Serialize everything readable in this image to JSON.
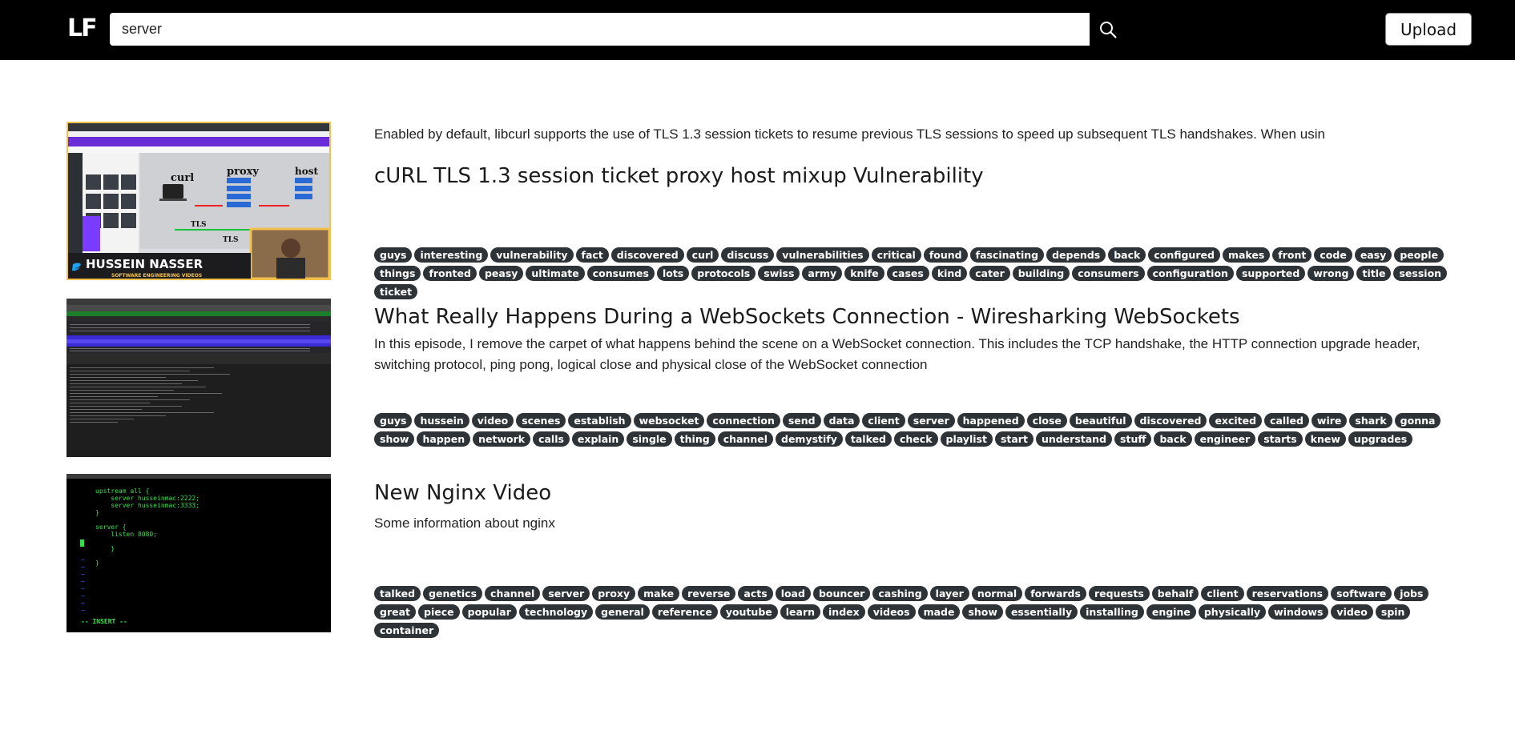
{
  "header": {
    "logo": "LF",
    "search_value": "server",
    "upload_label": "Upload"
  },
  "results": [
    {
      "snippet": "Enabled by default, libcurl supports the use of TLS 1.3 session tickets to resume previous TLS sessions to speed up subsequent TLS handshakes. When usin",
      "title": "cURL TLS 1.3 session ticket proxy host mixup Vulnerability",
      "thumbnail": {
        "labels": [
          "curl",
          "proxy",
          "host",
          "TLS",
          "TLS",
          "HUSSEIN NASSER",
          "SOFTWARE ENGINEERING VIDEOS"
        ]
      },
      "tags": [
        "guys",
        "interesting",
        "vulnerability",
        "fact",
        "discovered",
        "curl",
        "discuss",
        "vulnerabilities",
        "critical",
        "found",
        "fascinating",
        "depends",
        "back",
        "configured",
        "makes",
        "front",
        "code",
        "easy",
        "people",
        "things",
        "fronted",
        "peasy",
        "ultimate",
        "consumes",
        "lots",
        "protocols",
        "swiss",
        "army",
        "knife",
        "cases",
        "kind",
        "cater",
        "building",
        "consumers",
        "configuration",
        "supported",
        "wrong",
        "title",
        "session",
        "ticket"
      ]
    },
    {
      "title": "What Really Happens During a WebSockets Connection - Wiresharking WebSockets",
      "description": "In this episode, I remove the carpet of what happens behind the scene on a WebSocket connection. This includes the TCP handshake, the HTTP connection upgrade header, switching protocol, ping pong, logical close and physical close of the WebSocket connection",
      "tags": [
        "guys",
        "hussein",
        "video",
        "scenes",
        "establish",
        "websocket",
        "connection",
        "send",
        "data",
        "client",
        "server",
        "happened",
        "close",
        "beautiful",
        "discovered",
        "excited",
        "called",
        "wire",
        "shark",
        "gonna",
        "show",
        "happen",
        "network",
        "calls",
        "explain",
        "single",
        "thing",
        "channel",
        "demystify",
        "talked",
        "check",
        "playlist",
        "start",
        "understand",
        "stuff",
        "back",
        "engineer",
        "starts",
        "knew",
        "upgrades"
      ]
    },
    {
      "title": "New Nginx Video",
      "description": "Some information about nginx",
      "thumbnail": {
        "code_lines": [
          "upstream all {",
          "    server husseinmac:2222;",
          "    server husseinmac:3333;",
          "}",
          "",
          "server {",
          "    listen 8080;",
          "",
          "    }",
          "",
          "}"
        ],
        "status_line": "-- INSERT --"
      },
      "tags": [
        "talked",
        "genetics",
        "channel",
        "server",
        "proxy",
        "make",
        "reverse",
        "acts",
        "load",
        "bouncer",
        "cashing",
        "layer",
        "normal",
        "forwards",
        "requests",
        "behalf",
        "client",
        "reservations",
        "software",
        "jobs",
        "great",
        "piece",
        "popular",
        "technology",
        "general",
        "reference",
        "youtube",
        "learn",
        "index",
        "videos",
        "made",
        "show",
        "essentially",
        "installing",
        "engine",
        "physically",
        "windows",
        "video",
        "spin",
        "container"
      ]
    }
  ]
}
